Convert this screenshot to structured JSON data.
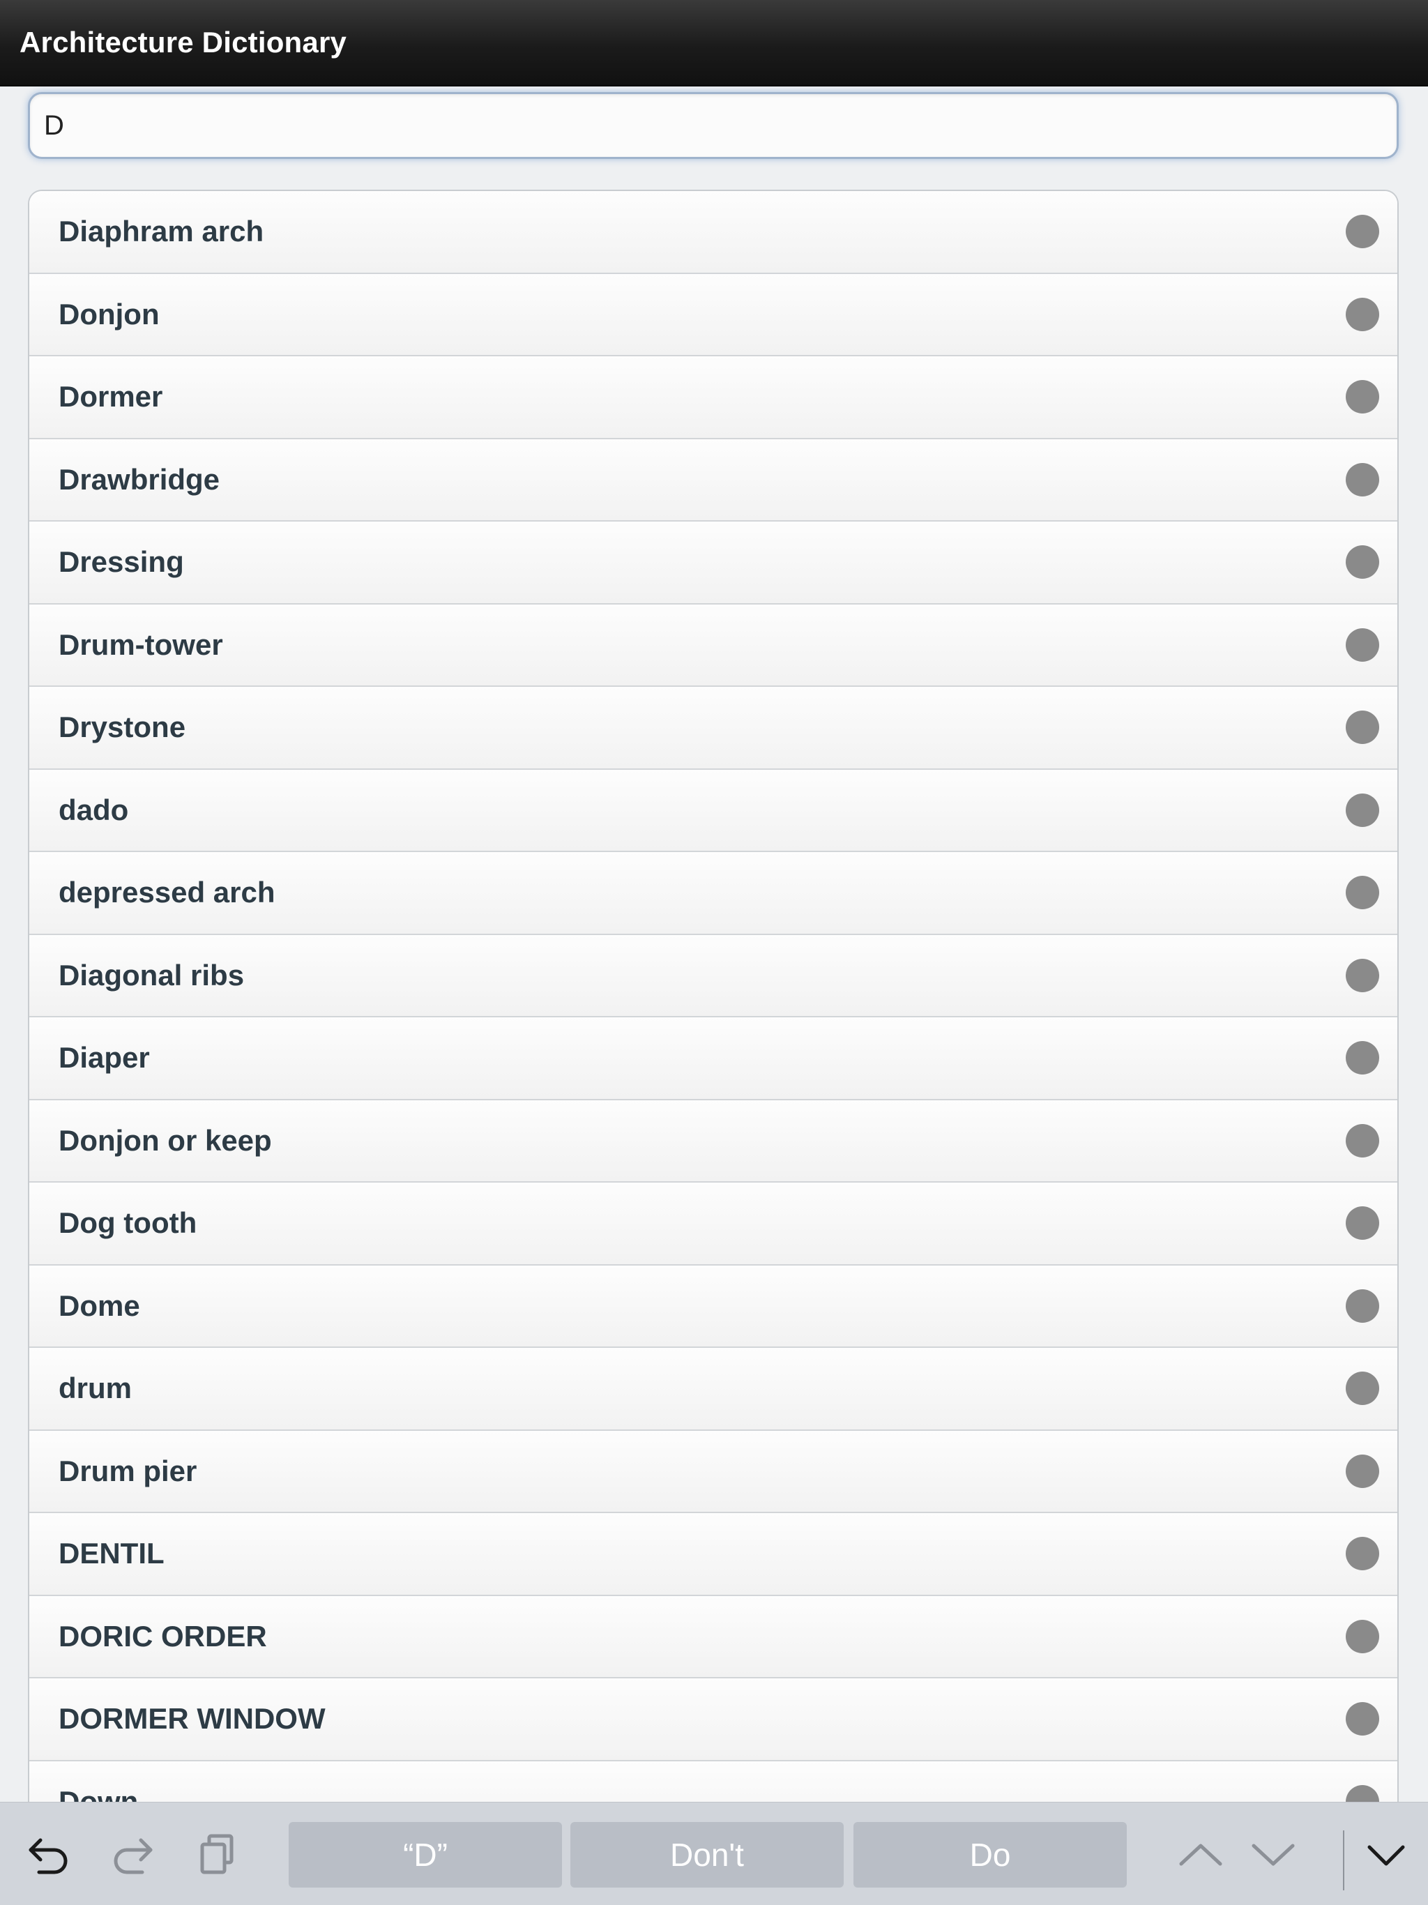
{
  "app": {
    "title": "Architecture Dictionary"
  },
  "search": {
    "value": "D"
  },
  "list": {
    "items": [
      "Diaphram arch",
      "Donjon",
      "Dormer",
      "Drawbridge",
      "Dressing",
      "Drum-tower",
      "Drystone",
      "dado",
      "depressed arch",
      "Diagonal ribs",
      "Diaper",
      "Donjon or keep",
      "Dog tooth",
      "Dome",
      "drum",
      "Drum pier",
      "DENTIL",
      "DORIC ORDER",
      "DORMER WINDOW",
      "Down"
    ]
  },
  "keyboard_toolbar": {
    "suggestions": [
      "“D”",
      "Don't",
      "Do"
    ],
    "icons": [
      "undo-icon",
      "redo-icon",
      "paste-icon",
      "chevron-up-icon",
      "chevron-down-icon",
      "dismiss-keyboard-icon"
    ]
  },
  "colors": {
    "header_background": "#1b1b1b",
    "row_text": "#2d3b45",
    "row_indicator": "#8a8a8a",
    "toolbar_background": "#d1d5db",
    "suggestion_background": "#b9bec6"
  }
}
